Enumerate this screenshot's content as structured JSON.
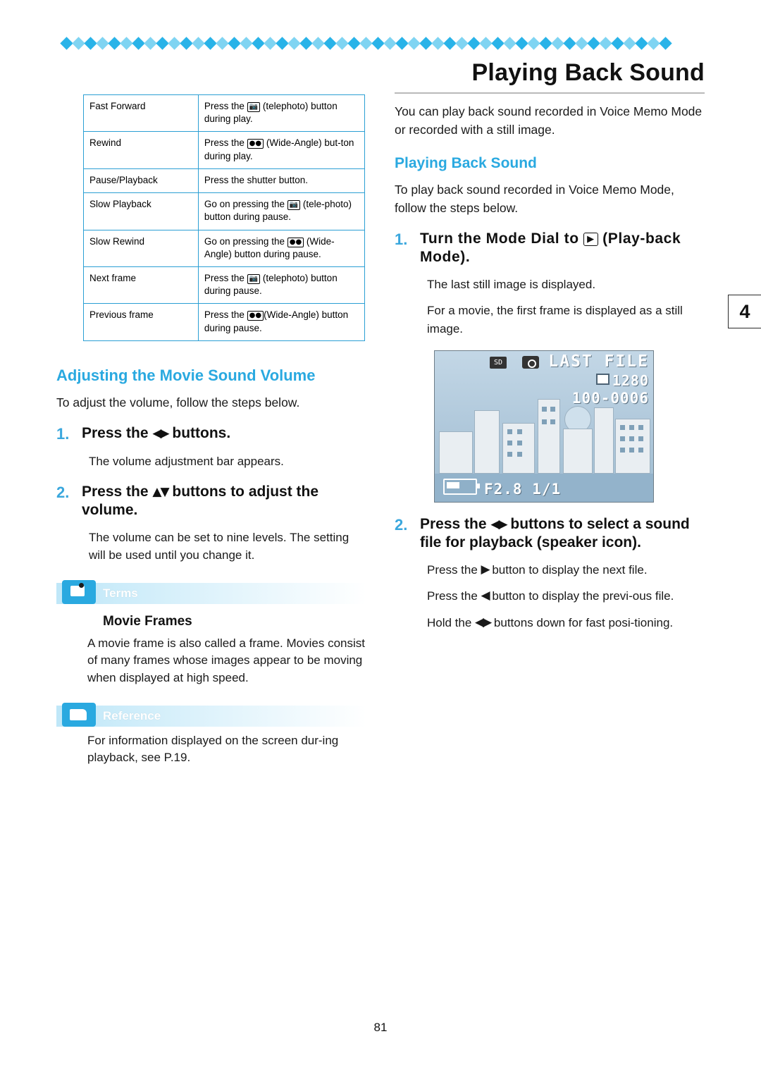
{
  "page": {
    "folio": "81",
    "chapter_tab": "4"
  },
  "left_column": {
    "table": {
      "rows": [
        {
          "action": "Fast Forward",
          "desc_pre": "Press the ",
          "icon": "telephoto-button-icon",
          "desc_post": " (telephoto) button during play."
        },
        {
          "action": "Rewind",
          "desc_pre": "Press the ",
          "icon": "wide-angle-button-icon",
          "desc_post": " (Wide-Angle) but-ton during play."
        },
        {
          "action": "Pause/Playback",
          "desc_pre": "Press the shutter button.",
          "icon": "",
          "desc_post": ""
        },
        {
          "action": "Slow Playback",
          "desc_pre": "Go on pressing the ",
          "icon": "telephoto-button-icon",
          "desc_post": " (tele-photo) button during pause."
        },
        {
          "action": "Slow Rewind",
          "desc_pre": "Go on pressing the ",
          "icon": "wide-angle-button-icon",
          "desc_post": " (Wide-Angle) button during pause."
        },
        {
          "action": "Next frame",
          "desc_pre": "Press the ",
          "icon": "telephoto-button-icon",
          "desc_post": " (telephoto) button during pause."
        },
        {
          "action": "Previous frame",
          "desc_pre": "Press the ",
          "icon": "wide-angle-button-icon",
          "desc_post": "(Wide-Angle) button during pause."
        }
      ]
    },
    "section_heading": "Adjusting the Movie Sound Volume",
    "intro": "To adjust the volume, follow the steps below.",
    "steps": [
      {
        "num": "1.",
        "title_pre": "Press the ",
        "arrows": "◀▶",
        "title_post": " buttons.",
        "body": "The volume adjustment bar appears."
      },
      {
        "num": "2.",
        "title_pre": "Press the ",
        "arrows": "▲▼",
        "title_post": " buttons to adjust the volume.",
        "body": "The volume can be set to nine levels. The setting will be used until you change it."
      }
    ],
    "terms_box": {
      "tag": "Terms",
      "title": "Movie Frames",
      "body": "A movie frame is also called a frame. Movies consist of many frames whose images appear to be moving when displayed at high speed."
    },
    "reference_box": {
      "tag": "Reference",
      "body": "For information displayed on the screen dur-ing playback, see P.19."
    }
  },
  "right_column": {
    "title": "Playing Back Sound",
    "intro": "You can play back sound recorded in Voice Memo Mode or recorded with a still image.",
    "section_heading": "Playing Back Sound",
    "section_intro": "To play back sound recorded in Voice Memo Mode, follow the steps below.",
    "step1": {
      "num": "1.",
      "title_pre": "Turn the Mode Dial to ",
      "icon": "playback-mode-icon",
      "title_post": " (Play-back Mode).",
      "body1": "The last still image is displayed.",
      "body2": "For a movie, the first frame is displayed as a still image."
    },
    "lcd": {
      "sd_label": "SD",
      "camera_icon": "camera-icon",
      "last_file": "LAST FILE",
      "resolution": "1280",
      "file_number": "100-0006",
      "exif": "F2.8 1/1",
      "battery_icon": "battery-icon"
    },
    "step2": {
      "num": "2.",
      "title_pre": "Press the ",
      "arrows": "◀▶",
      "title_post": " buttons to select a sound file for playback (speaker icon).",
      "line1_pre": "Press the ",
      "line1_arrow": "▶",
      "line1_post": " button to display the next file.",
      "line2_pre": "Press the ",
      "line2_arrow": "◀",
      "line2_post": " button to display the previ-ous file.",
      "line3_pre": "Hold the ",
      "line3_arrow": "◀▶",
      "line3_post": " buttons down for fast posi-tioning."
    }
  }
}
